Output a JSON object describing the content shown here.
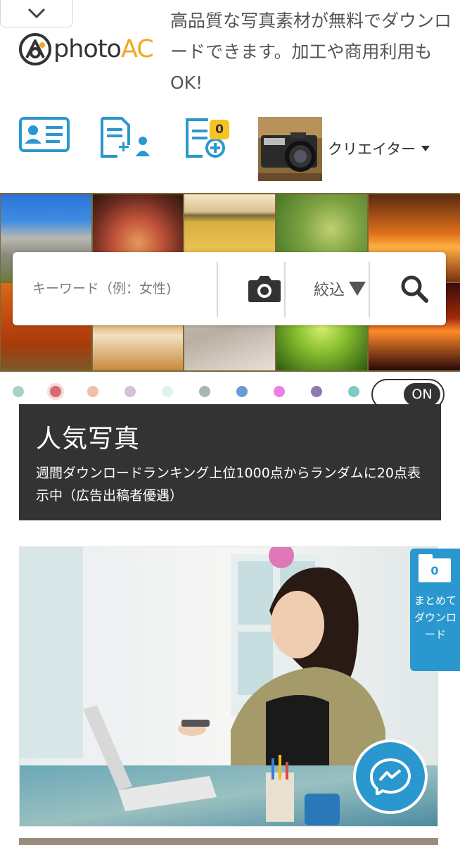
{
  "header": {
    "logo_photo": "photo",
    "logo_ac": "AC",
    "tagline": "高品質な写真素材が無料でダウンロードできます。加工や商用利用もOK!",
    "collapse_icon": "chevron-down-icon"
  },
  "toolbar": {
    "icons": [
      "profile-card-icon",
      "invite-user-icon",
      "document-add-icon"
    ],
    "badge_count": "0",
    "creator_label": "クリエイター"
  },
  "search": {
    "placeholder": "キーワード（例：女性)",
    "filter_label": "絞込",
    "camera_icon": "camera-icon",
    "search_icon": "search-icon"
  },
  "color_filter": {
    "colors": [
      "#a8d3c0",
      "#d86b6b",
      "#f2c0a8",
      "#d5c0d8",
      "#e0f0ee",
      "#a8b8b0",
      "#6a9ad8",
      "#ee7ee6",
      "#8a7ab0",
      "#7ccbc6"
    ],
    "selected_index": 1,
    "toggle_label": "ON"
  },
  "popular": {
    "title": "人気写真",
    "description": "週間ダウンロードランキング上位1000点からランダムに20点表示中（広告出稿者優遇）"
  },
  "bulk_download": {
    "count": "0",
    "label": "まとめてダウンロード"
  },
  "colors": {
    "brand_blue": "#2a98cf",
    "brand_orange": "#f1a81d",
    "panel_dark": "#333333",
    "badge_yellow": "#f6c325"
  }
}
